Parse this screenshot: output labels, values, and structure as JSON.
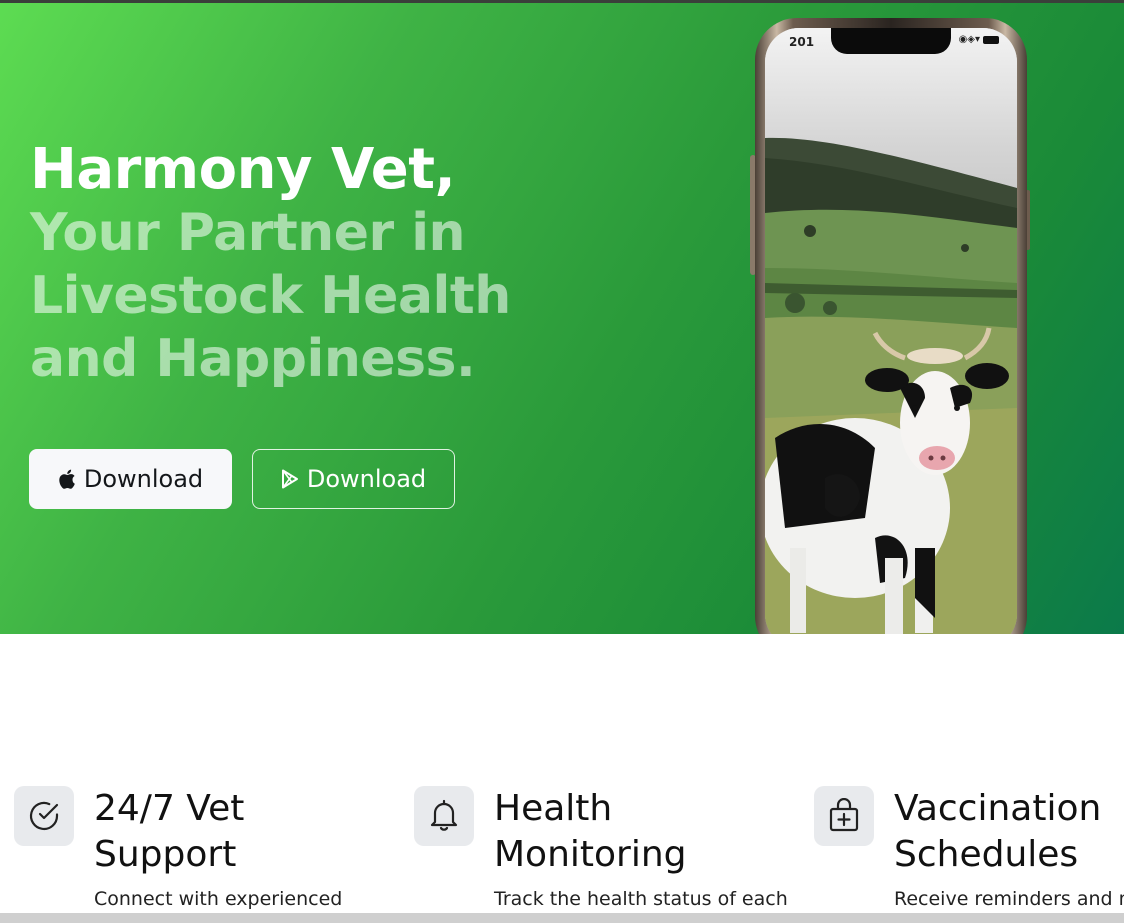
{
  "hero": {
    "title_line1": "Harmony Vet,",
    "title_line2": "Your Partner in",
    "title_line3": "Livestock Health",
    "title_line4": "and Happiness.",
    "buttons": [
      {
        "label": "Download",
        "icon": "apple-icon"
      },
      {
        "label": "Download",
        "icon": "google-play-icon"
      }
    ],
    "phone": {
      "status_time": "201",
      "status_right": "◉◈▾"
    }
  },
  "features": [
    {
      "title_line1": "24/7 Vet",
      "title_line2": "Support",
      "description": "Connect with experienced",
      "icon": "check-circle-icon"
    },
    {
      "title_line1": "Health",
      "title_line2": "Monitoring",
      "description": "Track the health status of each",
      "icon": "bell-icon"
    },
    {
      "title_line1": "Vaccination",
      "title_line2": "Schedules",
      "description": "Receive reminders and ma",
      "icon": "medical-bag-icon"
    }
  ],
  "colors": {
    "hero_gradient_start": "#5ddc52",
    "hero_gradient_end": "#0b7a4a",
    "title_white": "#ffffff",
    "icon_tile": "#e8eaed"
  }
}
